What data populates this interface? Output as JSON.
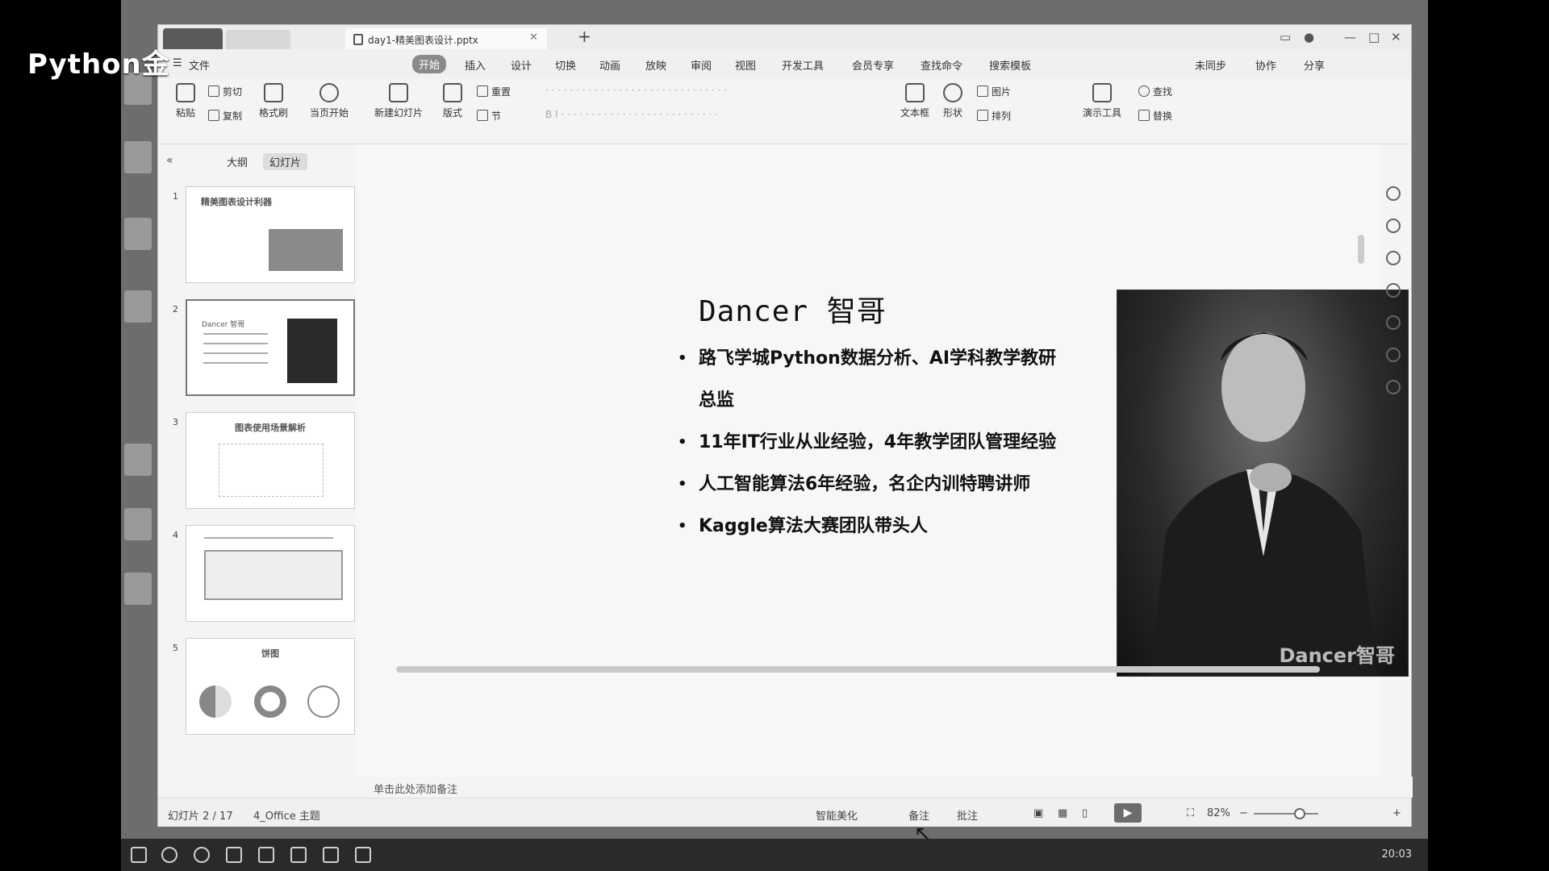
{
  "watermark": "Python金",
  "tabs": {
    "home": "",
    "second": "",
    "document": "day1-精美图表设计.pptx"
  },
  "menu": [
    "文件",
    "开始",
    "插入",
    "设计",
    "切换",
    "动画",
    "放映",
    "审阅",
    "视图",
    "开发工具",
    "会员专享",
    "查找命令",
    "搜索模板",
    "未同步",
    "协作",
    "分享"
  ],
  "ribbon": {
    "paste": "粘贴",
    "cut": "剪切",
    "copy": "复制",
    "format_painter": "格式刷",
    "play_from_current": "当页开始",
    "new_slide": "新建幻灯片",
    "layout": "版式",
    "section": "节",
    "reset": "重置",
    "textbox": "文本框",
    "shape": "形状",
    "picture": "图片",
    "arrange": "排列",
    "presentation_tools": "演示工具",
    "find": "查找",
    "replace": "替换"
  },
  "left_panel": {
    "tab_outline": "大纲",
    "tab_slides": "幻灯片",
    "thumbs": [
      {
        "num": "1",
        "title": "精美图表设计利器"
      },
      {
        "num": "2",
        "title": "Dancer 智哥"
      },
      {
        "num": "3",
        "title": "图表使用场景解析"
      },
      {
        "num": "4",
        "title": ""
      },
      {
        "num": "5",
        "title": "饼图"
      }
    ]
  },
  "slide": {
    "name": "Dancer  智哥",
    "bullets": [
      "路飞学城Python数据分析、AI学科教学教研总监",
      "11年IT行业从业经验，4年教学团队管理经验",
      "人工智能算法6年经验，名企内训特聘讲师",
      "Kaggle算法大赛团队带头人"
    ],
    "photo_credit": "Dancer智哥"
  },
  "notes_placeholder": "单击此处添加备注",
  "status": {
    "slide_counter": "幻灯片 2 / 17",
    "theme": "4_Office 主题",
    "smart_beautify": "智能美化",
    "notes": "备注",
    "comments": "批注",
    "zoom": "82%"
  },
  "taskbar": {
    "clock": "20:03"
  }
}
